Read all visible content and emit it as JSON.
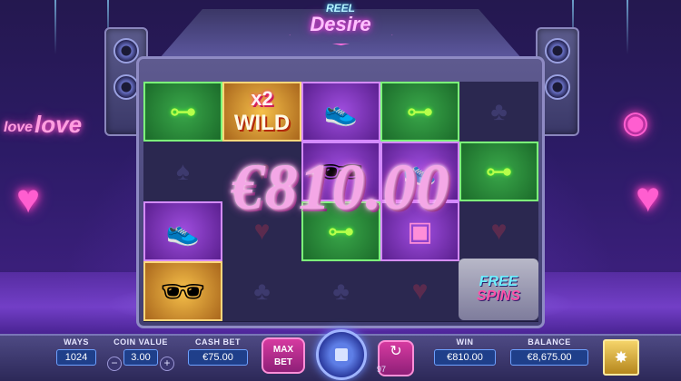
{
  "game": {
    "logo_top": "REEL",
    "logo_bottom": "Desire"
  },
  "background": {
    "sign_love_1": "love",
    "sign_love_2": "love"
  },
  "reels": {
    "wild_multiplier": "x2",
    "wild_label": "WILD",
    "free_spins_line1": "FREE",
    "free_spins_line2": "SPINS"
  },
  "win_overlay": {
    "amount": "€810.00"
  },
  "controls": {
    "ways_label": "WAYS",
    "ways_value": "1024",
    "coin_value_label": "COIN VALUE",
    "coin_value": "3.00",
    "cash_bet_label": "CASH BET",
    "cash_bet_value": "€75.00",
    "max_bet_line1": "MAX",
    "max_bet_line2": "BET",
    "autoplay_count": "97",
    "win_label": "WIN",
    "win_value": "€810.00",
    "balance_label": "BALANCE",
    "balance_value": "€8,675.00"
  },
  "colors": {
    "accent_pink": "#ff5ed0",
    "accent_blue": "#6da0ff",
    "panel_value_bg": "#1f3f8a"
  }
}
